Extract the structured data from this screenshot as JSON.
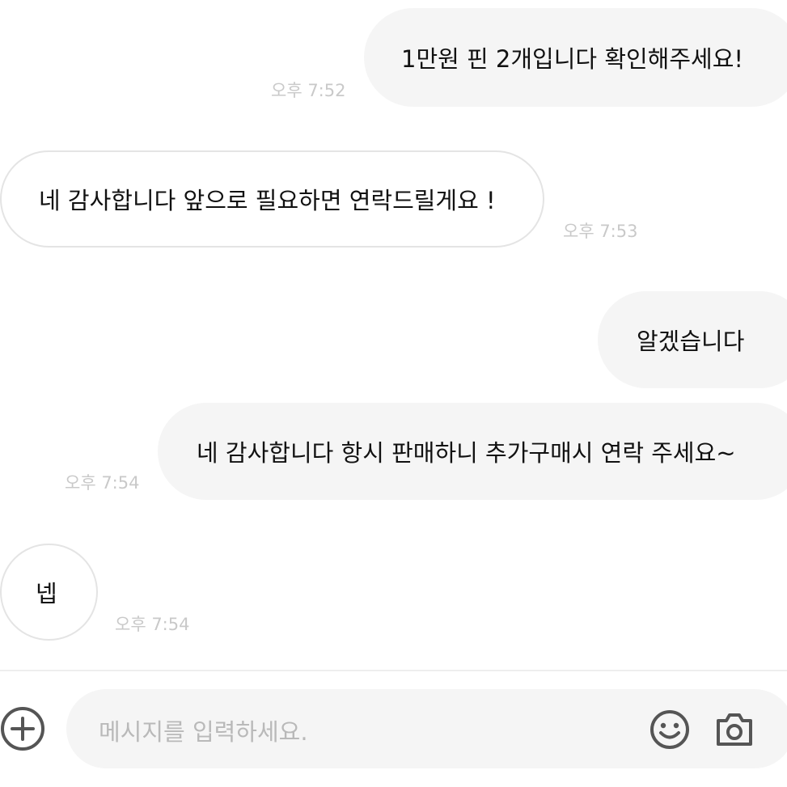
{
  "messages": [
    {
      "direction": "outgoing",
      "text": "1만원 핀 2개입니다 확인해주세요!",
      "time": "오후 7:52"
    },
    {
      "direction": "incoming",
      "text": "네 감사합니다 앞으로 필요하면 연락드릴게요 !",
      "time": "오후 7:53"
    },
    {
      "direction": "outgoing",
      "text": "알겠습니다",
      "time": ""
    },
    {
      "direction": "outgoing",
      "text": "네 감사합니다 항시 판매하니 추가구매시 연락 주세요~",
      "time": "오후 7:54"
    },
    {
      "direction": "incoming",
      "text": "넵",
      "time": "오후 7:54"
    }
  ],
  "composer": {
    "placeholder": "메시지를 입력하세요.",
    "add_icon": "plus-circle-icon",
    "emoji_icon": "smiley-icon",
    "camera_icon": "camera-icon"
  },
  "colors": {
    "outgoing_bubble": "#f5f5f5",
    "incoming_bubble_border": "#e4e4e4",
    "timestamp": "#c9c9c9",
    "placeholder": "#b9b9b9",
    "icon": "#555555"
  }
}
